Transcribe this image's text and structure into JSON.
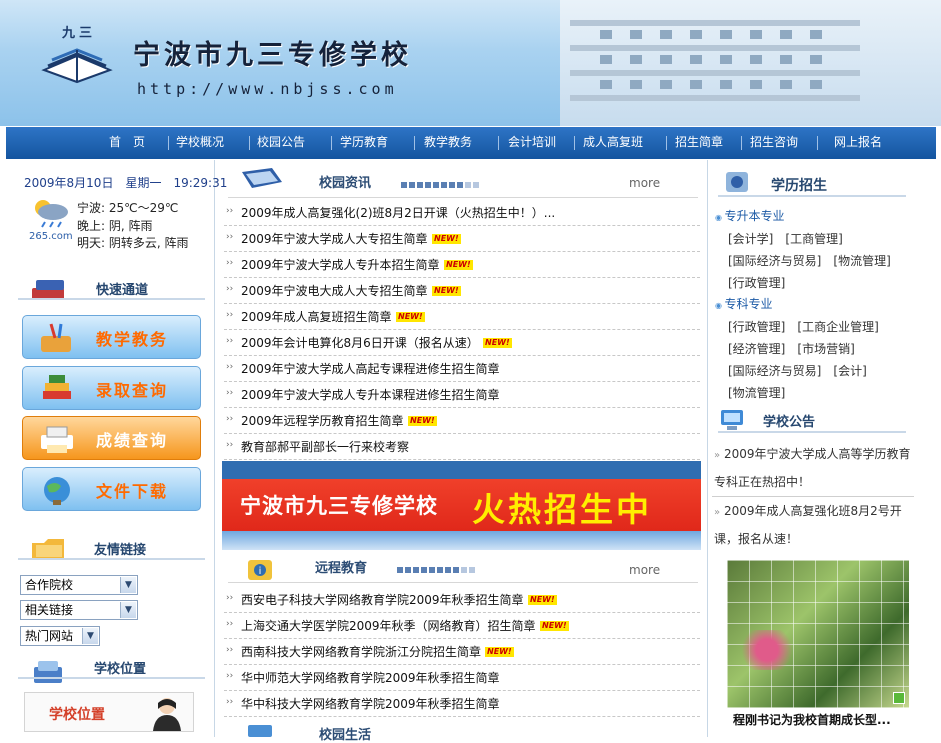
{
  "header": {
    "logo_mark": "九三",
    "title": "宁波市九三专修学校",
    "url": "http://www.nbjss.com"
  },
  "nav": [
    "首　页",
    "学校概况",
    "校园公告",
    "学历教育",
    "教学教务",
    "会计培训",
    "成人高复班",
    "招生简章",
    "招生咨询",
    "网上报名"
  ],
  "left": {
    "datetime": "2009年8月10日　星期一　19:29:31",
    "weather": {
      "brand": "265.com",
      "today": "宁波: 25℃～29℃",
      "tonight": "晚上: 阴, 阵雨",
      "tomorrow": "明天: 阴转多云, 阵雨"
    },
    "quick_title": "快速通道",
    "quick_buttons": [
      "教学教务",
      "录取查询",
      "成绩查询",
      "文件下载"
    ],
    "links_title": "友情链接",
    "selects": [
      "合作院校",
      "相关链接",
      "热门网站"
    ],
    "location_title": "学校位置",
    "location_button": "学校位置"
  },
  "middle": {
    "news_title": "校园资讯",
    "more": "more",
    "news": [
      {
        "text": "2009年成人高复强化(2)班8月2日开课（火热招生中！）...",
        "new": false
      },
      {
        "text": "2009年宁波大学成人大专招生简章",
        "new": true
      },
      {
        "text": "2009年宁波大学成人专升本招生简章",
        "new": true
      },
      {
        "text": "2009年宁波电大成人大专招生简章",
        "new": true
      },
      {
        "text": "2009年成人高复班招生简章",
        "new": true
      },
      {
        "text": "2009年会计电算化8月6日开课（报名从速）",
        "new": true
      },
      {
        "text": "2009年宁波大学成人高起专课程进修生招生简章",
        "new": false
      },
      {
        "text": "2009年宁波大学成人专升本课程进修生招生简章",
        "new": false
      },
      {
        "text": "2009年远程学历教育招生简章",
        "new": true
      },
      {
        "text": "教育部郝平副部长一行来校考察",
        "new": false
      }
    ],
    "banner_left": "宁波市九三专修学校",
    "banner_right": "火热招生中",
    "remote_title": "远程教育",
    "remote": [
      {
        "text": "西安电子科技大学网络教育学院2009年秋季招生简章",
        "new": true
      },
      {
        "text": "上海交通大学医学院2009年秋季（网络教育）招生简章",
        "new": true
      },
      {
        "text": "西南科技大学网络教育学院浙江分院招生简章",
        "new": true
      },
      {
        "text": "华中师范大学网络教育学院2009年秋季招生简章",
        "new": false
      },
      {
        "text": "华中科技大学网络教育学院2009年秋季招生简章",
        "new": false
      }
    ],
    "campus_title": "校园生活",
    "new_badge": "NEW!"
  },
  "right": {
    "recruit_title": "学历招生",
    "cat1": "专升本专业",
    "cat1_links": [
      [
        "[会计学]",
        "[工商管理]"
      ],
      [
        "[国际经济与贸易]",
        "[物流管理]"
      ],
      [
        "[行政管理]"
      ]
    ],
    "cat2": "专科专业",
    "cat2_links": [
      [
        "[行政管理]",
        "[工商企业管理]"
      ],
      [
        "[经济管理]",
        "[市场营销]"
      ],
      [
        "[国际经济与贸易]",
        "[会计]"
      ],
      [
        "[物流管理]"
      ]
    ],
    "notice_title": "学校公告",
    "notices": [
      "2009年宁波大学成人高等学历教育专科正在热招中！",
      "2009年成人高复强化班8月2号开课，报名从速！"
    ],
    "photo_caption": "程刚书记为我校首期成长型..."
  }
}
